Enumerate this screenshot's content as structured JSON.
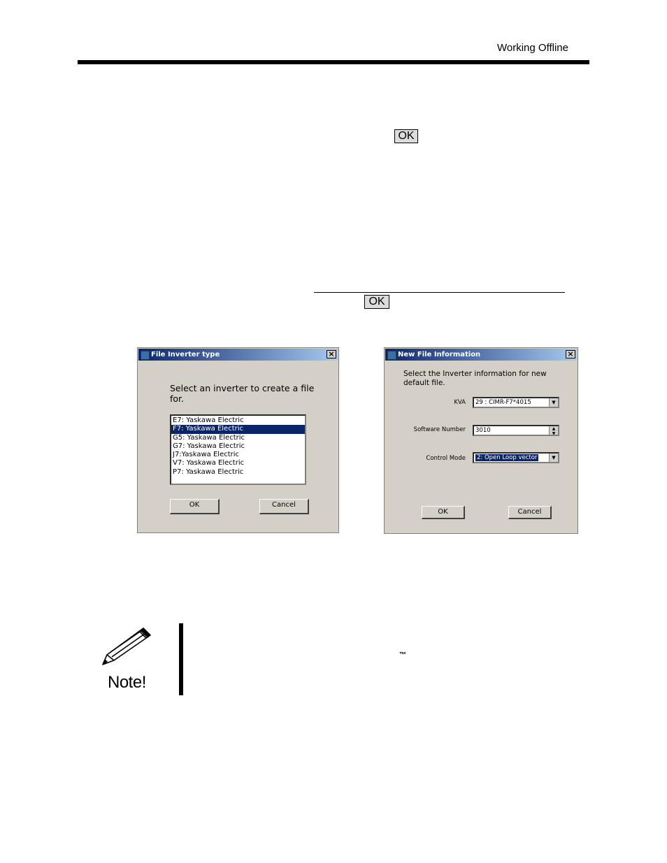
{
  "header": {
    "section_title": "Working Offline"
  },
  "inline_buttons": {
    "ok_1": "OK",
    "ok_2": "OK"
  },
  "dialog_inverter": {
    "title": "File Inverter type",
    "prompt": "Select an inverter to create a file for.",
    "items": [
      "E7: Yaskawa Electric",
      "F7: Yaskawa Electric",
      "G5: Yaskawa Electric",
      "G7: Yaskawa Electric",
      "J7:Yaskawa Electric",
      "V7: Yaskawa Electric",
      "P7: Yaskawa Electric"
    ],
    "selected_item": "F7: Yaskawa Electric",
    "ok_label": "OK",
    "cancel_label": "Cancel",
    "close_glyph": "×"
  },
  "dialog_newfile": {
    "title": "New File Information",
    "prompt": "Select the Inverter information for new default file.",
    "kva_label": "KVA",
    "kva_value": "29 : CIMR-F7*4015",
    "software_label": "Software Number",
    "software_value": "3010",
    "control_mode_label": "Control Mode",
    "control_mode_value": "2: Open Loop vector",
    "ok_label": "OK",
    "cancel_label": "Cancel",
    "close_glyph": "×"
  },
  "note": {
    "label": "Note!",
    "trademark": "™",
    "icon": "pencil-icon"
  }
}
